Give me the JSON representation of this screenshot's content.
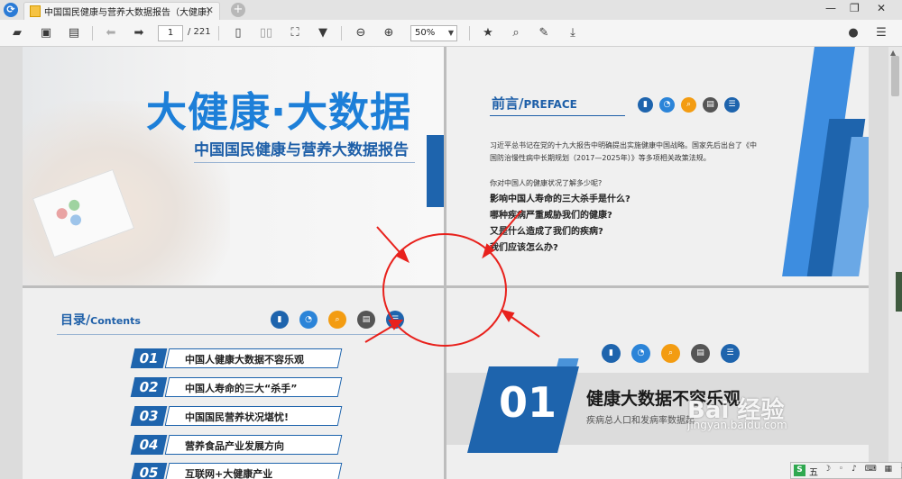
{
  "tab": {
    "title": "中国国民健康与营养大数据报告（大健康）"
  },
  "toolbar": {
    "page_current": "1",
    "page_total": "/ 221",
    "zoom": "50%"
  },
  "slide1": {
    "title": "大健康·大数据",
    "subtitle": "中国国民健康与营养大数据报告"
  },
  "slide2": {
    "heading": "前言/",
    "heading_en": "PREFACE",
    "para1": "习近平总书记在党的十九大报告中明确提出实施健康中国战略。国家先后出台了《中",
    "para2": "国防治慢性病中长期规划（2017—2025年）》等多项相关政策法规。",
    "intro": "你对中国人的健康状况了解多少呢?",
    "questions": [
      "影响中国人寿命的三大杀手是什么?",
      "哪种疾病严重威胁我们的健康?",
      "又是什么造成了我们的疾病?",
      "我们应该怎么办?"
    ]
  },
  "slide3": {
    "heading": "目录/",
    "heading_en": "Contents",
    "items": [
      {
        "num": "01",
        "label": "中国人健康大数据不容乐观"
      },
      {
        "num": "02",
        "label": "中国人寿命的三大“杀手”"
      },
      {
        "num": "03",
        "label": "中国国民营养状况堪忧!"
      },
      {
        "num": "04",
        "label": "营养食品产业发展方向"
      },
      {
        "num": "05",
        "label": "互联网+大健康产业"
      }
    ]
  },
  "slide4": {
    "num": "01",
    "title": "健康大数据不容乐观",
    "subtitle": "疾病总人口和发病率数据起"
  },
  "watermark": {
    "logo": "Bai 经验",
    "url": "jingyan.baidu.com"
  },
  "ime": {
    "logo": "S",
    "mode": "五"
  },
  "colors": {
    "accent_blue": "#1e64ad",
    "title_blue": "#1d7fd8",
    "annotation_red": "#e8211c",
    "icon_orange": "#f39c12"
  }
}
